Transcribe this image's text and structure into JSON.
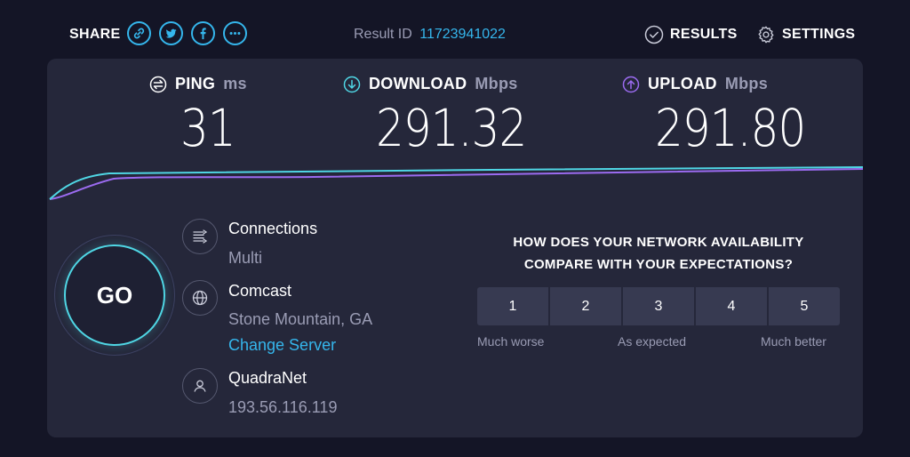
{
  "topbar": {
    "share_label": "SHARE",
    "share_buttons": [
      "link-icon",
      "twitter-icon",
      "facebook-icon",
      "more-icon"
    ],
    "result_id_label": "Result ID",
    "result_id_value": "11723941022",
    "results_label": "RESULTS",
    "settings_label": "SETTINGS"
  },
  "metrics": {
    "ping": {
      "label": "PING",
      "unit": "ms",
      "value": "31"
    },
    "download": {
      "label": "DOWNLOAD",
      "unit": "Mbps",
      "value": "291.32"
    },
    "upload": {
      "label": "UPLOAD",
      "unit": "Mbps",
      "value": "291.80"
    }
  },
  "go_label": "GO",
  "info": {
    "connections_title": "Connections",
    "connections_value": "Multi",
    "isp_name": "Comcast",
    "isp_location": "Stone Mountain, GA",
    "change_server_label": "Change Server",
    "host_name": "QuadraNet",
    "host_ip": "193.56.116.119"
  },
  "survey": {
    "question": "HOW DOES YOUR NETWORK AVAILABILITY COMPARE WITH YOUR EXPECTATIONS?",
    "options": [
      "1",
      "2",
      "3",
      "4",
      "5"
    ],
    "low_label": "Much worse",
    "mid_label": "As expected",
    "high_label": "Much better"
  },
  "colors": {
    "accent": "#35b6ec",
    "download_line": "#4fd6e4",
    "upload_line": "#9b6bf0",
    "panel": "#25273a",
    "background": "#141526"
  }
}
